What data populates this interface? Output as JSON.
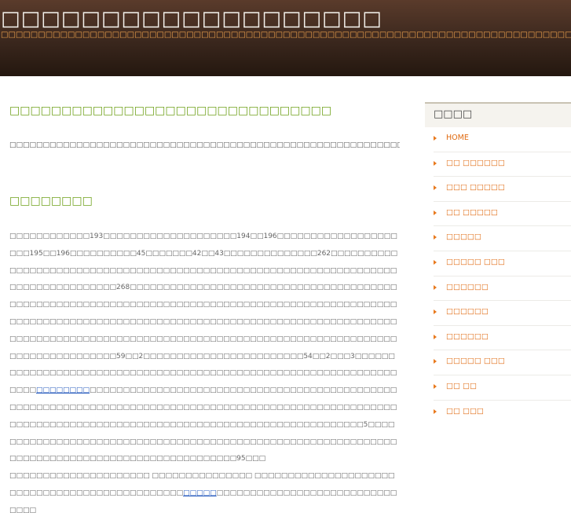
{
  "header": {
    "title": "□□□□□□□□□□□□□□□□□□□",
    "tagline": "□□□□□□□□□□□□□□□□□□□□□□□□□□□□□□□□□□□□□□□□□□□□□□□□□□□□□□□□□□□□□□□□□□□□□□□□□□□□□"
  },
  "main": {
    "post_title": "□□□□□□□□□□□□□□□□□□□□□□□□□□□□□□□",
    "intro": "□□□□□□□□□□□□□□□□□□□□□□□□□□□□□□□□□□□□□□□□□□□□□□□□□□□□□□□□□□□□□□□□□□□□□□□□□□□□□□□□□□□□",
    "section_title": "□□□□□□□□",
    "body_1": "□□□□□□□□□□□□193□□□□□□□□□□□□□□□□□□□□194□□196□□□□□□□□□□□□□□□□□□□□□195□□196□□□□□□□□□□45□□□□□□□42□□43□□□□□□□□□□□□□□262□□□□□□□□□□□□□□□□□□□□□□□□□□□□□□□□□□□□□□□□□□□□□□□□□□□□□□□□□□□□□□□□□□□□□□□□□□□□□□□□□□□□268□□□□□□□□□□□□□□□□□□□□□□□□□□□□□□□□□□□□□□□□□□□□□□□□□□□□□□□□□□□□□□□□□□□□□□□□□□□□□□□□□□□□□□□□□□□□□□□□□□□□□□□□□□□□□□□□□□□□□□□□□□□□□□□□□□□□□□□□□□□□□□□□□□□□□□□□□□□□□□□□□□□□□□□□□□□□□□□□□□□□□□□□□□□□□□□□□□□□□□□□□□□□□□□□□□□□□□□□□□□□□□□□□□□□□□59□□2□□□□□□□□□□□□□□□□□□□□□□□□54□□2□□□3□□□□□□□□□□□□□□□□□□□□□□□□□□□□□□□□□□□□□□□□□□□□□□□□□□□□□□□□□□□□□□□□□□□□",
    "link_1": "□□□□□□□□",
    "body_2": "□□□□□□□□□□□□□□□□□□□□□□□□□□□□□□□□□□□□□□□□□□□□□□□□□□□□□□□□□□□□□□□□□□□□□□□□□□□□□□□□□□□□□□□□□□□□□□□□□□□□□□□□□□□□□□□□□□□□□□□□□□□□□□□□□□□□□□□□□□□□□□□□□□□□□□□□□□□□□5□□□□□□□□□□□□□□□□□□□□□□□□□□□□□□□□□□□□□□□□□□□□□□□□□□□□□□□□□□□□□□□□□□□□□□□□□□□□□□□□□□□□□□□□□□□□□□□□95□□□",
    "body_3": "□□□□□□□□□□□□□□□□□□□□□ □□□□□□□□□□□□□□□ □□□□□□□□□□□□□□□□□□□□□□□□□□□□□□□□□□□□□□□□□□□□□□□",
    "link_2": "□□□□□",
    "body_4": "□□□□□□□□□□□□□□□□□□□□□□□□□□□□□□□"
  },
  "sidebar": {
    "widget_title": "□□□□",
    "items": [
      {
        "label": "HOME"
      },
      {
        "label": "□□ □□□□□□"
      },
      {
        "label": "□□□ □□□□□"
      },
      {
        "label": "□□ □□□□□"
      },
      {
        "label": "□□□□□"
      },
      {
        "label": "□□□□□ □□□"
      },
      {
        "label": "□□□□□□"
      },
      {
        "label": "□□□□□□"
      },
      {
        "label": "□□□□□□"
      },
      {
        "label": "□□□□□ □□□"
      },
      {
        "label": "□□ □□"
      },
      {
        "label": "□□ □□□"
      }
    ]
  }
}
